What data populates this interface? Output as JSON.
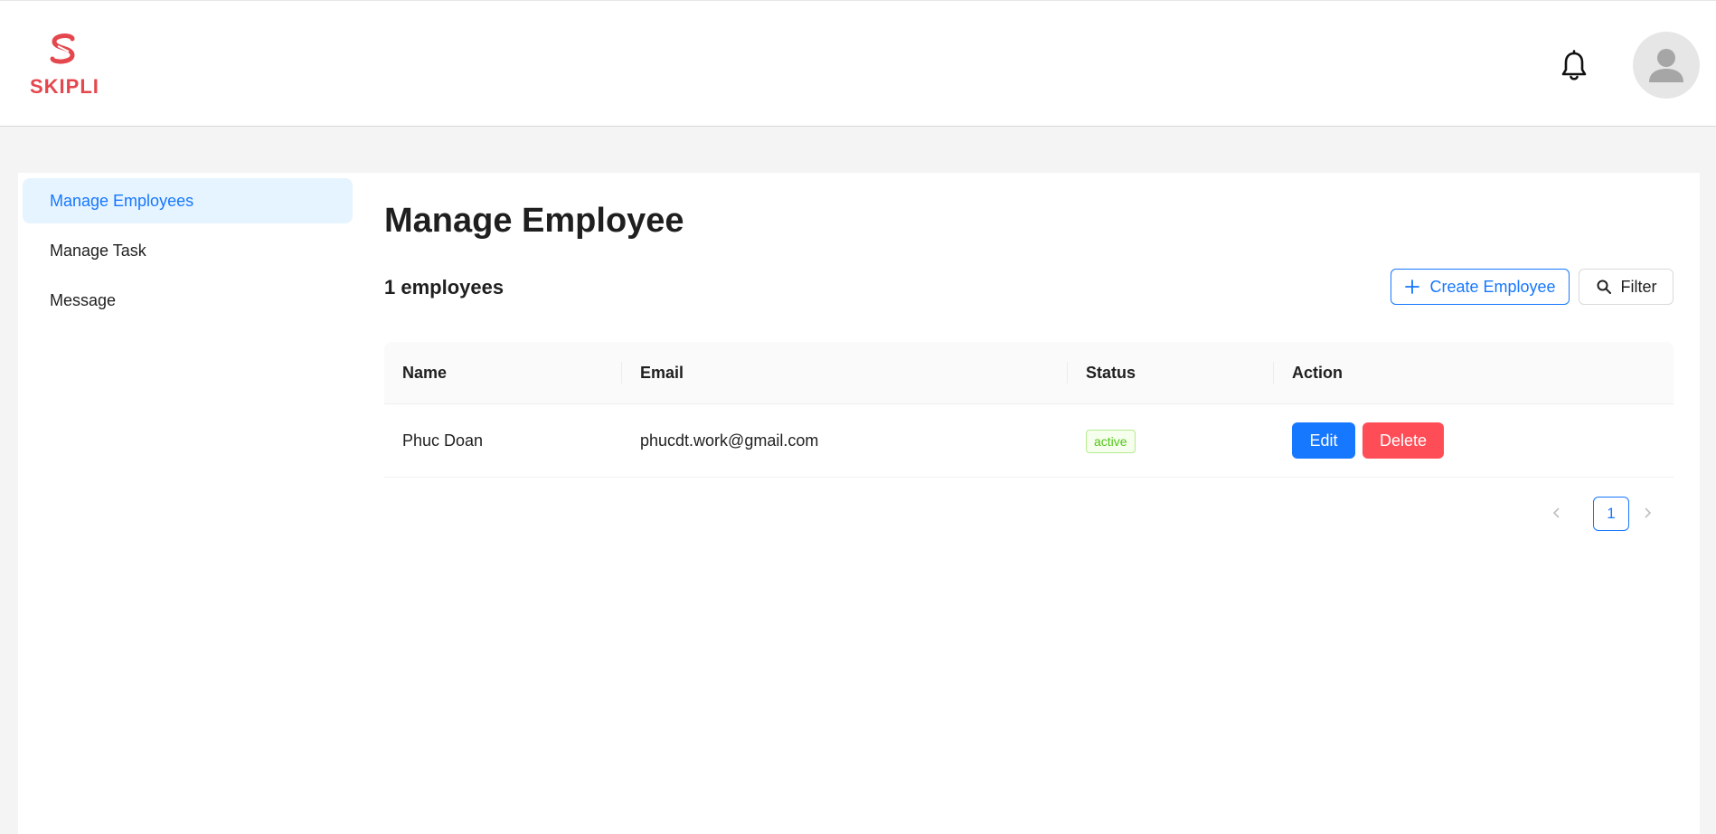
{
  "header": {
    "logo_text": "SKIPLI",
    "bell_icon": "bell-icon",
    "avatar_icon": "user-avatar-icon"
  },
  "sidebar": {
    "items": [
      {
        "label": "Manage Employees",
        "active": true
      },
      {
        "label": "Manage Task",
        "active": false
      },
      {
        "label": "Message",
        "active": false
      }
    ]
  },
  "main": {
    "title": "Manage Employee",
    "count_text": "1 employees",
    "create_button": "Create Employee",
    "filter_button": "Filter",
    "table": {
      "columns": [
        "Name",
        "Email",
        "Status",
        "Action"
      ],
      "rows": [
        {
          "name": "Phuc Doan",
          "email": "phucdt.work@gmail.com",
          "status": "active",
          "edit_label": "Edit",
          "delete_label": "Delete"
        }
      ]
    },
    "pagination": {
      "current_page": "1",
      "prev_icon": "chevron-left-icon",
      "next_icon": "chevron-right-icon"
    }
  },
  "colors": {
    "brand": "#e5474e",
    "primary": "#1677ff",
    "danger": "#ff4d57",
    "success": "#52c41a",
    "active_nav_bg": "#e6f4ff"
  }
}
